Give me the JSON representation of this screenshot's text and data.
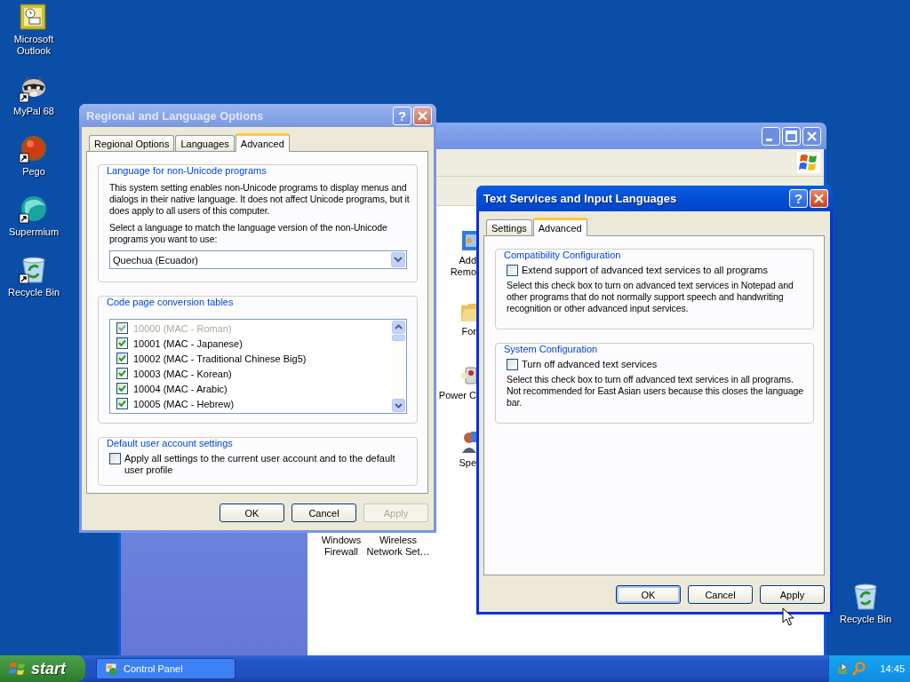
{
  "desktop": {
    "icons": [
      {
        "label": "Microsoft\nOutlook",
        "kind": "outlook",
        "shortcut": false
      },
      {
        "label": "MyPal 68",
        "kind": "raccoon",
        "shortcut": true
      },
      {
        "label": "Pego",
        "kind": "redball",
        "shortcut": true
      },
      {
        "label": "Supermium",
        "kind": "globe",
        "shortcut": true
      },
      {
        "label": "Recycle Bin",
        "kind": "recycle",
        "shortcut": true
      }
    ],
    "right_icons": [
      {
        "label": "Recycle Bin",
        "kind": "recycle",
        "shortcut": false
      }
    ]
  },
  "control_panel": {
    "items": [
      {
        "label": "Add\nRemo",
        "kind": "software"
      },
      {
        "label": "For",
        "kind": "folder"
      },
      {
        "label": "Power C",
        "kind": "power"
      },
      {
        "label": "Spe",
        "kind": "speech"
      },
      {
        "label": "Windows\nFirewall",
        "kind": "none"
      },
      {
        "label": "Wireless\nNetwork Set…",
        "kind": "none"
      }
    ]
  },
  "regional_dialog": {
    "title": "Regional and Language Options",
    "help": "?",
    "tabs": [
      {
        "label": "Regional Options",
        "selected": false
      },
      {
        "label": "Languages",
        "selected": false
      },
      {
        "label": "Advanced",
        "selected": true
      }
    ],
    "non_unicode": {
      "legend": "Language for non-Unicode programs",
      "description": "This system setting enables non-Unicode programs to display menus and dialogs in their native language. It does not affect Unicode programs, but it does apply to all users of this computer.",
      "prompt": "Select a language to match the language version of the non-Unicode programs you want to use:",
      "language": "Quechua (Ecuador)"
    },
    "code_pages": {
      "legend": "Code page conversion tables",
      "rows": [
        {
          "label": "10000 (MAC - Roman)",
          "checked": true,
          "disabled": true
        },
        {
          "label": "10001 (MAC - Japanese)",
          "checked": true,
          "disabled": false
        },
        {
          "label": "10002 (MAC - Traditional Chinese Big5)",
          "checked": true,
          "disabled": false
        },
        {
          "label": "10003 (MAC - Korean)",
          "checked": true,
          "disabled": false
        },
        {
          "label": "10004 (MAC - Arabic)",
          "checked": true,
          "disabled": false
        },
        {
          "label": "10005 (MAC - Hebrew)",
          "checked": true,
          "disabled": false
        }
      ]
    },
    "default_user": {
      "legend": "Default user account settings",
      "label": "Apply all settings to the current user account and to the default user profile",
      "checked": false
    },
    "buttons": [
      {
        "label": "OK",
        "disabled": false,
        "default": false
      },
      {
        "label": "Cancel",
        "disabled": false,
        "default": false
      },
      {
        "label": "Apply",
        "disabled": true,
        "default": false
      }
    ]
  },
  "text_services_dialog": {
    "title": "Text Services and Input Languages",
    "help": "?",
    "tabs": [
      {
        "label": "Settings",
        "selected": false
      },
      {
        "label": "Advanced",
        "selected": true
      }
    ],
    "sections": [
      {
        "legend": "Compatibility Configuration",
        "label": "Extend support of advanced text services to all programs",
        "checked": false,
        "description": "Select this check box to turn on advanced text services in Notepad and other programs that do not normally support speech and handwriting recognition or other advanced input services."
      },
      {
        "legend": "System Configuration",
        "label": "Turn off advanced text services",
        "checked": false,
        "description": "Select this check box to turn off advanced text services in all programs. Not recommended for East Asian users because this closes the language bar."
      }
    ],
    "buttons": [
      {
        "label": "OK",
        "disabled": false,
        "default": true
      },
      {
        "label": "Cancel",
        "disabled": false,
        "default": false
      },
      {
        "label": "Apply",
        "disabled": false,
        "default": false
      }
    ]
  },
  "taskbar": {
    "start": "start",
    "tasks": [
      {
        "label": "Control Panel",
        "selected": false
      }
    ],
    "clock": "14:45"
  }
}
